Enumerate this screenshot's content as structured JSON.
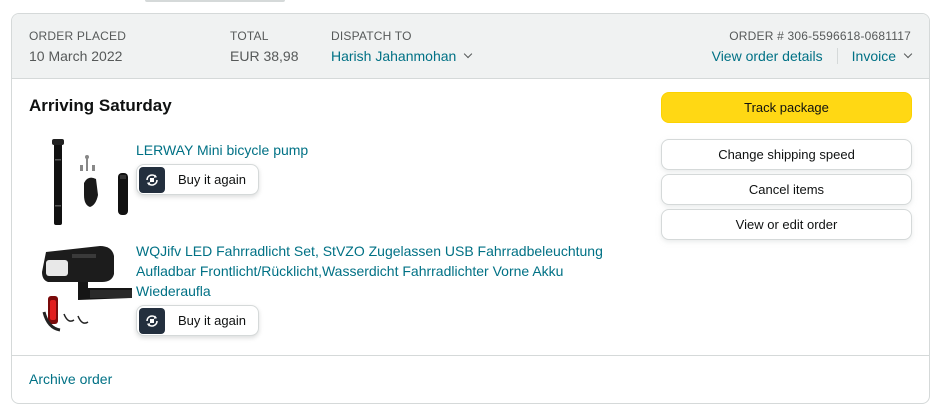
{
  "order_header": {
    "order_placed_label": "ORDER PLACED",
    "order_placed_value": "10 March 2022",
    "total_label": "TOTAL",
    "total_value": "EUR 38,98",
    "dispatch_label": "DISPATCH TO",
    "dispatch_value": "Harish Jahanmohan",
    "order_number": "ORDER # 306-5596618-0681117",
    "view_details_label": "View order details",
    "invoice_label": "Invoice"
  },
  "shipment": {
    "status": "Arriving Saturday"
  },
  "items": [
    {
      "title_line1": "LERWAY Mini bicycle pump",
      "buy_again_label": "Buy it again"
    },
    {
      "title_line1": "WQJifv LED Fahrradlicht Set, StVZO Zugelassen USB Fahrradbeleuchtung",
      "title_line2": "Aufladbar Frontlicht/Rücklicht,Wasserdicht Fahrradlichter Vorne Akku",
      "title_line3": "Wiederaufla",
      "buy_again_label": "Buy it again"
    }
  ],
  "actions": {
    "track": "Track package",
    "change_speed": "Change shipping speed",
    "cancel": "Cancel items",
    "view_edit": "View or edit order"
  },
  "footer": {
    "archive": "Archive order"
  },
  "colors": {
    "link": "#007185",
    "primary_button": "#FFD814",
    "header_bg": "#F0F2F2",
    "border": "#D5D9D9"
  }
}
